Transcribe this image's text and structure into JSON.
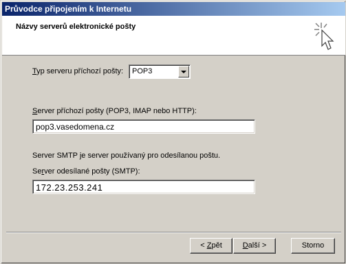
{
  "window": {
    "title": "Průvodce připojením k Internetu"
  },
  "header": {
    "title": "Názvy serverů elektronické pošty",
    "icon": "wizard-wand-icon"
  },
  "incoming_type": {
    "label_prefix": "T",
    "label_rest": "yp serveru příchozí pošty:",
    "selected": "POP3"
  },
  "incoming_server": {
    "label_prefix": "S",
    "label_rest": "erver příchozí pošty (POP3, IMAP nebo HTTP):",
    "value": "pop3.vasedomena.cz"
  },
  "smtp_info": "Server SMTP je server používaný pro odesílanou poštu.",
  "outgoing_server": {
    "label_pre": "Se",
    "label_underline": "r",
    "label_rest": "ver odesílané pošty (SMTP):",
    "value": "172.23.253.241"
  },
  "buttons": {
    "back_pre": "< ",
    "back_underline": "Z",
    "back_rest": "pět",
    "next_underline": "D",
    "next_rest": "alší >",
    "cancel": "Storno"
  }
}
